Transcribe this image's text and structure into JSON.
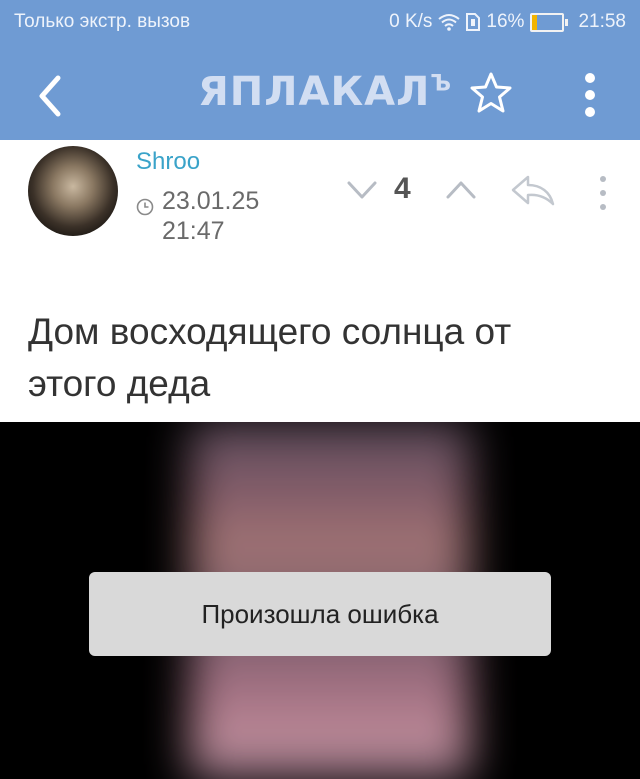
{
  "status_bar": {
    "left_text": "Только экстр. вызов",
    "speed": "0 K/s",
    "battery": "16%",
    "battery_level": 0.16,
    "time": "21:58"
  },
  "header": {
    "logo": "ЯПЛАКАЛ",
    "logo_suffix": "Ъ",
    "bg_color": "#6f9bd3"
  },
  "post": {
    "author": "Shroo",
    "date": "23.01.25",
    "time": "21:47",
    "score": "4",
    "title": "Дом восходящего солнца от этого деда"
  },
  "video": {
    "error": "Произошла ошибка"
  },
  "icons": [
    "back-arrow-icon",
    "star-icon",
    "more-vertical-icon",
    "clock-icon",
    "chevron-down-icon",
    "chevron-up-icon",
    "reply-icon",
    "wifi-icon",
    "sim-icon",
    "battery-icon"
  ]
}
